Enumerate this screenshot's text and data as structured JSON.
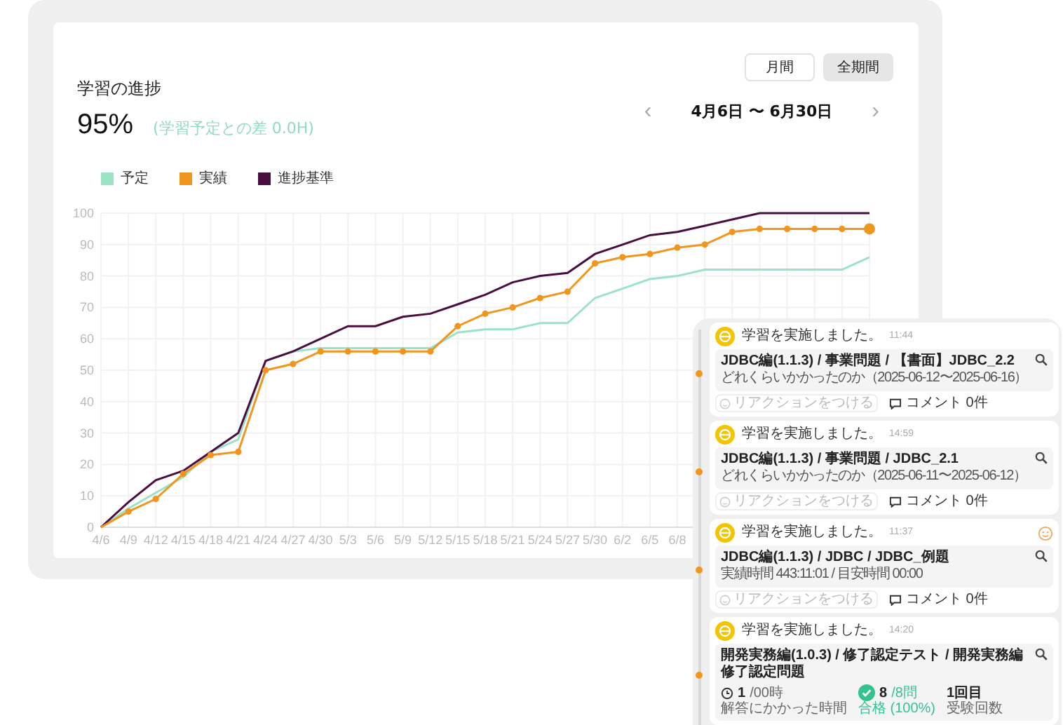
{
  "progress": {
    "title": "学習の進捗",
    "percent": "95%",
    "diff": "(学習予定との差 0.0H)",
    "period_tabs": [
      {
        "label": "月間",
        "selected": false
      },
      {
        "label": "全期間",
        "selected": true
      }
    ],
    "date_nav": {
      "prev": "‹",
      "range": "4月6日 〜 6月30日",
      "next": "›"
    },
    "chart_data": {
      "type": "line",
      "categories": [
        "4/6",
        "4/9",
        "4/12",
        "4/15",
        "4/18",
        "4/21",
        "4/24",
        "4/27",
        "4/30",
        "5/3",
        "5/6",
        "5/9",
        "5/12",
        "5/15",
        "5/18",
        "5/21",
        "5/24",
        "5/27",
        "5/30",
        "6/2",
        "6/5",
        "6/8",
        null,
        null,
        null,
        null,
        null,
        null,
        null
      ],
      "ylim": [
        0,
        100
      ],
      "yticks": [
        0,
        10,
        20,
        30,
        40,
        50,
        60,
        70,
        80,
        90,
        100
      ],
      "grid": true,
      "series": [
        {
          "name": "予定",
          "color": "#9be3c6",
          "values": [
            0,
            6,
            11,
            16,
            24,
            28,
            53,
            56,
            57,
            57,
            57,
            57,
            57,
            62,
            63,
            63,
            65,
            65,
            73,
            76,
            79,
            80,
            82,
            82,
            82,
            82,
            82,
            82,
            86
          ]
        },
        {
          "name": "実績",
          "color": "#f0961e",
          "marker": "circle",
          "values": [
            0,
            5,
            9,
            17,
            23,
            24,
            50,
            52,
            56,
            56,
            56,
            56,
            56,
            64,
            68,
            70,
            73,
            75,
            84,
            86,
            87,
            89,
            90,
            94,
            95,
            95,
            95,
            95,
            95
          ]
        },
        {
          "name": "進捗基準",
          "color": "#4a0d3f",
          "values": [
            0,
            8,
            15,
            18,
            24,
            30,
            53,
            56,
            60,
            64,
            64,
            67,
            68,
            71,
            74,
            78,
            80,
            81,
            87,
            90,
            93,
            94,
            96,
            98,
            100,
            100,
            100,
            100,
            100
          ]
        }
      ]
    }
  },
  "feed": [
    {
      "kind": "detail",
      "title": "学習を実施しました。",
      "time": "11:44",
      "reaction_badge": false,
      "content": {
        "title": "JDBC編(1.1.3) / 事業問題 / 【書面】JDBC_2.2",
        "note": "どれくらいかかったのか（2025-06-12〜2025-06-16）"
      },
      "reaction": "リアクションをつける",
      "comments": "コメント 0件"
    },
    {
      "kind": "detail",
      "title": "学習を実施しました。",
      "time": "14:59",
      "reaction_badge": false,
      "content": {
        "title": "JDBC編(1.1.3) / 事業問題 / JDBC_2.1",
        "note": "どれくらいかかったのか（2025-06-11〜2025-06-12）"
      },
      "reaction": "リアクションをつける",
      "comments": "コメント 0件"
    },
    {
      "kind": "detail",
      "title": "学習を実施しました。",
      "time": "11:37",
      "reaction_badge": true,
      "content": {
        "title": "JDBC編(1.1.3) / JDBC / JDBC_例題",
        "note": "実績時間 443:11:01 / 目安時間 00:00"
      },
      "reaction": "リアクションをつける",
      "comments": "コメント 0件"
    },
    {
      "kind": "test",
      "title": "学習を実施しました。",
      "time": "14:20",
      "reaction_badge": false,
      "content": {
        "title": "開発実務編(1.0.3) / 修了認定テスト / 開発実務編修了認定問題",
        "stats": [
          {
            "kind": "time",
            "value": "1",
            "unit": "/00時",
            "label": "解答にかかった時間"
          },
          {
            "kind": "score",
            "value": "8",
            "unit": "/8問",
            "label": "合格 (100%)"
          },
          {
            "kind": "count",
            "value": "1回目",
            "label": "受験回数"
          }
        ]
      }
    }
  ]
}
